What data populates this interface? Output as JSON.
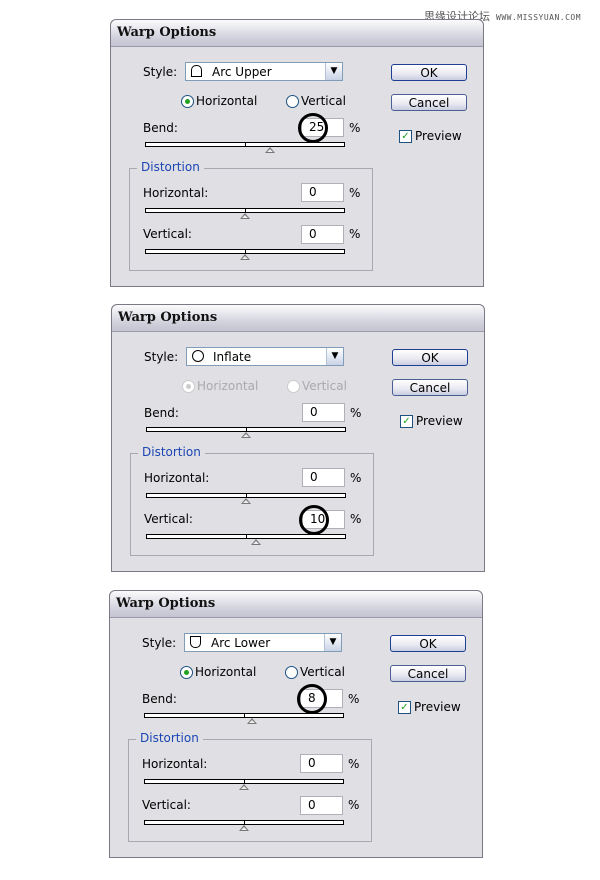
{
  "watermark": {
    "cn": "思缘设计论坛",
    "url": "WWW.MISSYUAN.COM"
  },
  "dialogs": [
    {
      "title": "Warp Options",
      "style_label": "Style:",
      "style_value": "Arc Upper",
      "style_icon": "arc-upper-icon",
      "horizontal_label": "Horizontal",
      "vertical_label": "Vertical",
      "orientation": "horizontal",
      "orientation_enabled": true,
      "bend_label": "Bend:",
      "bend": "25",
      "percent": "%",
      "ok": "OK",
      "cancel": "Cancel",
      "preview": "Preview",
      "preview_checked": true,
      "distortion_label": "Distortion",
      "dist_h_label": "Horizontal:",
      "dist_h": "0",
      "dist_v_label": "Vertical:",
      "dist_v": "0",
      "highlighted_field": "bend"
    },
    {
      "title": "Warp Options",
      "style_label": "Style:",
      "style_value": "Inflate",
      "style_icon": "inflate-icon",
      "horizontal_label": "Horizontal",
      "vertical_label": "Vertical",
      "orientation": "horizontal",
      "orientation_enabled": false,
      "bend_label": "Bend:",
      "bend": "0",
      "percent": "%",
      "ok": "OK",
      "cancel": "Cancel",
      "preview": "Preview",
      "preview_checked": true,
      "distortion_label": "Distortion",
      "dist_h_label": "Horizontal:",
      "dist_h": "0",
      "dist_v_label": "Vertical:",
      "dist_v": "10",
      "highlighted_field": "dist_v"
    },
    {
      "title": "Warp Options",
      "style_label": "Style:",
      "style_value": "Arc Lower",
      "style_icon": "arc-lower-icon",
      "horizontal_label": "Horizontal",
      "vertical_label": "Vertical",
      "orientation": "horizontal",
      "orientation_enabled": true,
      "bend_label": "Bend:",
      "bend": "8",
      "percent": "%",
      "ok": "OK",
      "cancel": "Cancel",
      "preview": "Preview",
      "preview_checked": true,
      "distortion_label": "Distortion",
      "dist_h_label": "Horizontal:",
      "dist_h": "0",
      "dist_v_label": "Vertical:",
      "dist_v": "0",
      "highlighted_field": "bend"
    }
  ]
}
